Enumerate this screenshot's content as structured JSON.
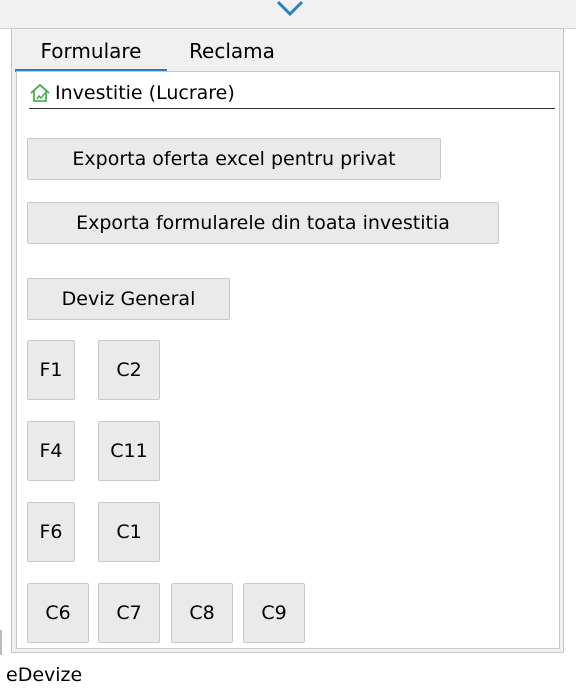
{
  "tabs": [
    {
      "label": "Formulare",
      "active": true
    },
    {
      "label": "Reclama",
      "active": false
    }
  ],
  "breadcrumb": {
    "icon": "home-icon",
    "label": "Investitie (Lucrare)"
  },
  "buttons": {
    "export_private": "Exporta oferta excel pentru privat",
    "export_all": "Exporta formularele din toata investitia",
    "deviz_general": "Deviz General",
    "forms": [
      [
        "F1",
        "C2"
      ],
      [
        "F4",
        "C11"
      ],
      [
        "F6",
        "C1"
      ],
      [
        "C6",
        "C7",
        "C8",
        "C9"
      ]
    ]
  },
  "status": {
    "text": "eDevize"
  },
  "colors": {
    "accent": "#2c7cc6",
    "home_icon": "#3aa63a"
  }
}
